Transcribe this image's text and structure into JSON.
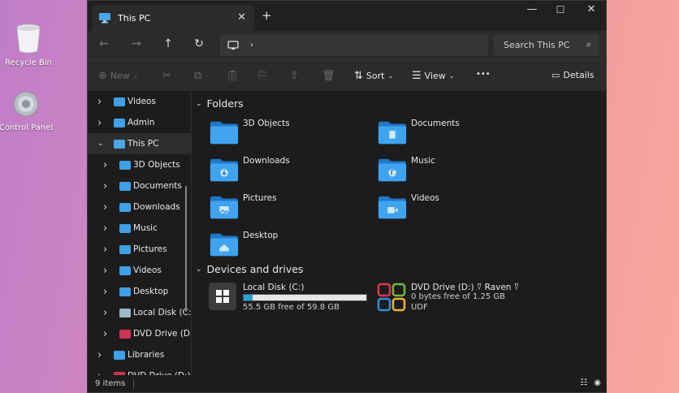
{
  "desktop": {
    "icons": [
      {
        "label": "Recycle Bin"
      },
      {
        "label": "Control Panel"
      }
    ]
  },
  "window": {
    "tab_title": "This PC",
    "search_placeholder": "Search This PC",
    "toolbar": {
      "new_label": "New",
      "sort_label": "Sort",
      "view_label": "View",
      "more_label": "•••",
      "details_label": "Details"
    },
    "sidebar": {
      "items": [
        {
          "label": "Videos",
          "level": 0,
          "chev": "right",
          "color": "#3fa0e6"
        },
        {
          "label": "Admin",
          "level": 0,
          "chev": "right",
          "color": "#3fa0e6"
        },
        {
          "label": "This PC",
          "level": 0,
          "chev": "down",
          "color": "#4aa6ea",
          "selected": true
        },
        {
          "label": "3D Objects",
          "level": 1,
          "chev": "right",
          "color": "#3fa0e6"
        },
        {
          "label": "Documents",
          "level": 1,
          "chev": "right",
          "color": "#3fa0e6"
        },
        {
          "label": "Downloads",
          "level": 1,
          "chev": "right",
          "color": "#3fa0e6"
        },
        {
          "label": "Music",
          "level": 1,
          "chev": "right",
          "color": "#3fa0e6"
        },
        {
          "label": "Pictures",
          "level": 1,
          "chev": "right",
          "color": "#3fa0e6"
        },
        {
          "label": "Videos",
          "level": 1,
          "chev": "right",
          "color": "#3fa0e6"
        },
        {
          "label": "Desktop",
          "level": 1,
          "chev": "right",
          "color": "#3fa0e6"
        },
        {
          "label": "Local Disk (C:",
          "level": 1,
          "chev": "right",
          "color": "#9fb8c8"
        },
        {
          "label": "DVD Drive (D:",
          "level": 1,
          "chev": "right",
          "color": "#cc3355"
        },
        {
          "label": "Libraries",
          "level": 0,
          "chev": "right",
          "color": "#3fa0e6"
        },
        {
          "label": "DVD Drive (D:)",
          "level": 0,
          "chev": "right",
          "color": "#cc3355"
        }
      ]
    },
    "main": {
      "folders_header": "Folders",
      "folders": [
        {
          "label": "3D Objects",
          "glyph": ""
        },
        {
          "label": "Documents",
          "glyph": "doc"
        },
        {
          "label": "Downloads",
          "glyph": "down"
        },
        {
          "label": "Music",
          "glyph": "music"
        },
        {
          "label": "Pictures",
          "glyph": "pic"
        },
        {
          "label": "Videos",
          "glyph": "vid"
        },
        {
          "label": "Desktop",
          "glyph": "home"
        }
      ],
      "drives_header": "Devices and drives",
      "drives": [
        {
          "label": "Local Disk (C:)",
          "free": "55.5 GB free of 59.8 GB",
          "used_fraction": 0.072
        },
        {
          "label": "DVD Drive (D:) ⍢ Raven ⍢",
          "free": "0 bytes free of 1.25 GB",
          "fs": "UDF"
        }
      ]
    },
    "status": {
      "count": "9 items"
    }
  }
}
